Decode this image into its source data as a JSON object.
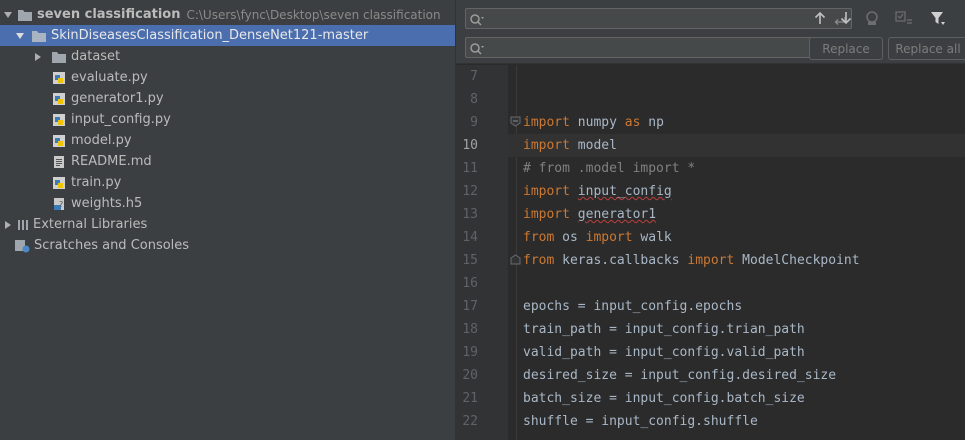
{
  "project_tree": {
    "root": {
      "name": "seven classification",
      "path": "C:\\Users\\fync\\Desktop\\seven classification"
    },
    "module": "SkinDiseasesClassification_DenseNet121-master",
    "folder": "dataset",
    "files": [
      "evaluate.py",
      "generator1.py",
      "input_config.py",
      "model.py",
      "README.md",
      "train.py",
      "weights.h5"
    ],
    "external_libraries": "External Libraries",
    "scratches": "Scratches and Consoles"
  },
  "find_bar": {
    "search_value": "",
    "replace_value": "",
    "replace_label": "Replace",
    "replace_all_label": "Replace all"
  },
  "editor": {
    "current_line": 10,
    "line_numbers": [
      "7",
      "8",
      "9",
      "10",
      "11",
      "12",
      "13",
      "14",
      "15",
      "16",
      "17",
      "18",
      "19",
      "20",
      "21",
      "22"
    ],
    "lines": [
      "",
      "",
      "import numpy as np",
      "import model",
      "# from .model import *",
      "import input_config",
      "import generator1",
      "from os import walk",
      "from keras.callbacks import ModelCheckpoint",
      "",
      "epochs = input_config.epochs",
      "train_path = input_config.trian_path",
      "valid_path = input_config.valid_path",
      "desired_size = input_config.desired_size",
      "batch_size = input_config.batch_size",
      "shuffle = input_config.shuffle"
    ]
  },
  "colors": {
    "keyword": "#cc7832",
    "comment": "#808080",
    "text": "#a9b7c6",
    "selection": "#4b6eaf"
  }
}
